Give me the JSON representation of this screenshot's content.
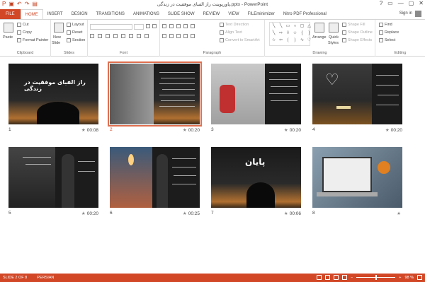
{
  "window": {
    "title": "پاورپوینت راز الفبای موفقیت در زندگی.pptx - PowerPoint",
    "controls": [
      "?",
      "▭",
      "—",
      "▢",
      "✕"
    ]
  },
  "qat": [
    "save-icon",
    "undo-icon",
    "redo-icon",
    "start-icon"
  ],
  "tabs": [
    "FILE",
    "HOME",
    "INSERT",
    "DESIGN",
    "TRANSITIONS",
    "ANIMATIONS",
    "SLIDE SHOW",
    "REVIEW",
    "VIEW",
    "FILEminimizer",
    "Nitro PDF Professional"
  ],
  "active_tab": "HOME",
  "signin": "Sign in",
  "ribbon": {
    "clipboard": {
      "label": "Clipboard",
      "paste": "Paste",
      "cut": "Cut",
      "copy": "Copy",
      "format_painter": "Format Painter"
    },
    "slides": {
      "label": "Slides",
      "new_slide": "New",
      "new_slide2": "Slide",
      "layout": "Layout",
      "reset": "Reset",
      "section": "Section"
    },
    "font": {
      "label": "Font"
    },
    "paragraph": {
      "label": "Paragraph",
      "text_direction": "Text Direction",
      "align_text": "Align Text",
      "smartart": "Convert to SmartArt"
    },
    "drawing": {
      "label": "Drawing",
      "arrange": "Arrange",
      "quick_styles": "Quick",
      "quick_styles2": "Styles",
      "shape_fill": "Shape Fill",
      "shape_outline": "Shape Outline",
      "shape_effects": "Shape Effects"
    },
    "editing": {
      "label": "Editing",
      "find": "Find",
      "replace": "Replace",
      "select": "Select"
    }
  },
  "slides": [
    {
      "num": "1",
      "time": "00:08",
      "title": "راز الفبای موفقیت در زندگی"
    },
    {
      "num": "2",
      "time": "00:20",
      "title": ""
    },
    {
      "num": "3",
      "time": "00:20",
      "title": ""
    },
    {
      "num": "4",
      "time": "00:20",
      "title": ""
    },
    {
      "num": "5",
      "time": "00:20",
      "title": ""
    },
    {
      "num": "6",
      "time": "00:25",
      "title": ""
    },
    {
      "num": "7",
      "time": "00:06",
      "title": "پایان"
    },
    {
      "num": "8",
      "time": "",
      "title": ""
    }
  ],
  "selected_slide": 2,
  "status": {
    "slide": "SLIDE 2 OF 8",
    "language": "PERSIAN",
    "zoom": "98 %"
  },
  "colors": {
    "accent": "#d24726",
    "selection": "#e07050"
  }
}
